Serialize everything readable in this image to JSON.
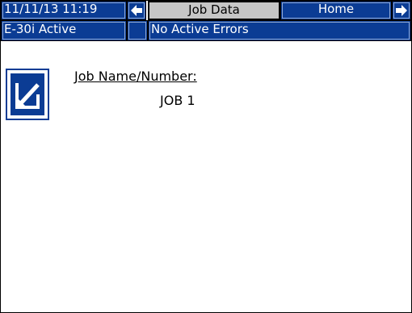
{
  "header": {
    "datetime": "11/11/13 11:19",
    "prev_icon": "arrow-left-icon",
    "tab_current": "Job Data",
    "tab_home": "Home",
    "next_icon": "arrow-right-icon"
  },
  "status": {
    "system": "E-30i Active",
    "indicator": "",
    "errors": "No Active Errors"
  },
  "content": {
    "edit_icon": "edit-pencil-icon",
    "field_label": "Job Name/Number:",
    "field_value": "JOB 1"
  },
  "colors": {
    "bar": "#0b3c94",
    "selected_tab": "#c6c6c6",
    "background": "#ffffff"
  }
}
